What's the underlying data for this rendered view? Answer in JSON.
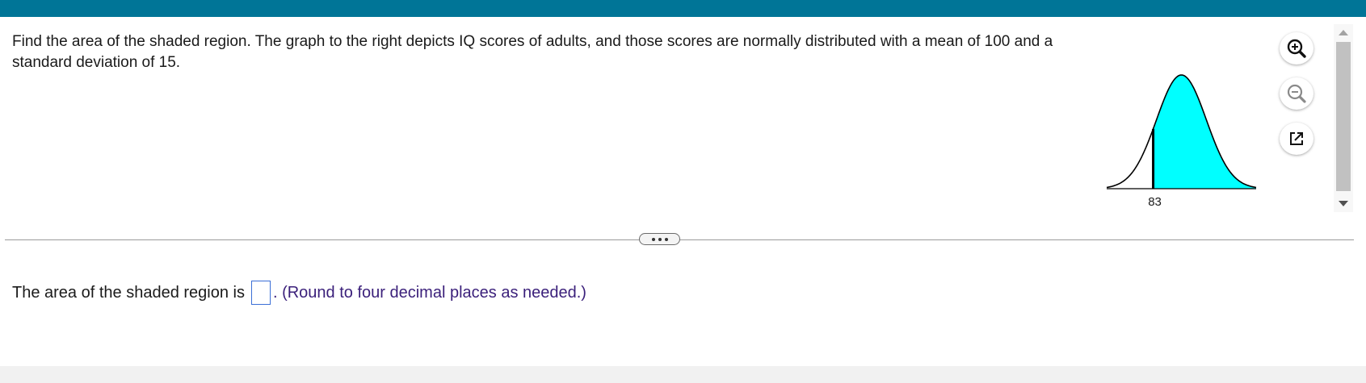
{
  "question": {
    "text": "Find the area of the shaded region. The graph to the right depicts IQ scores of adults, and those scores are normally distributed with a mean of 100 and a standard deviation of 15."
  },
  "figure": {
    "cutoff_label": "83",
    "mean": 100,
    "sd": 15,
    "cutoff": 83,
    "shade_color": "#00ffff"
  },
  "tools": {
    "zoom_in_icon": "zoom-in-icon",
    "zoom_out_icon": "zoom-out-icon",
    "popout_icon": "external-link-icon"
  },
  "answer": {
    "prefix": "The area of the shaded region is",
    "value": "",
    "hint": ". (Round to four decimal places as needed.)"
  },
  "colors": {
    "header": "#007597",
    "hint": "#3a1f7a",
    "input_border": "#3b6fd6"
  }
}
